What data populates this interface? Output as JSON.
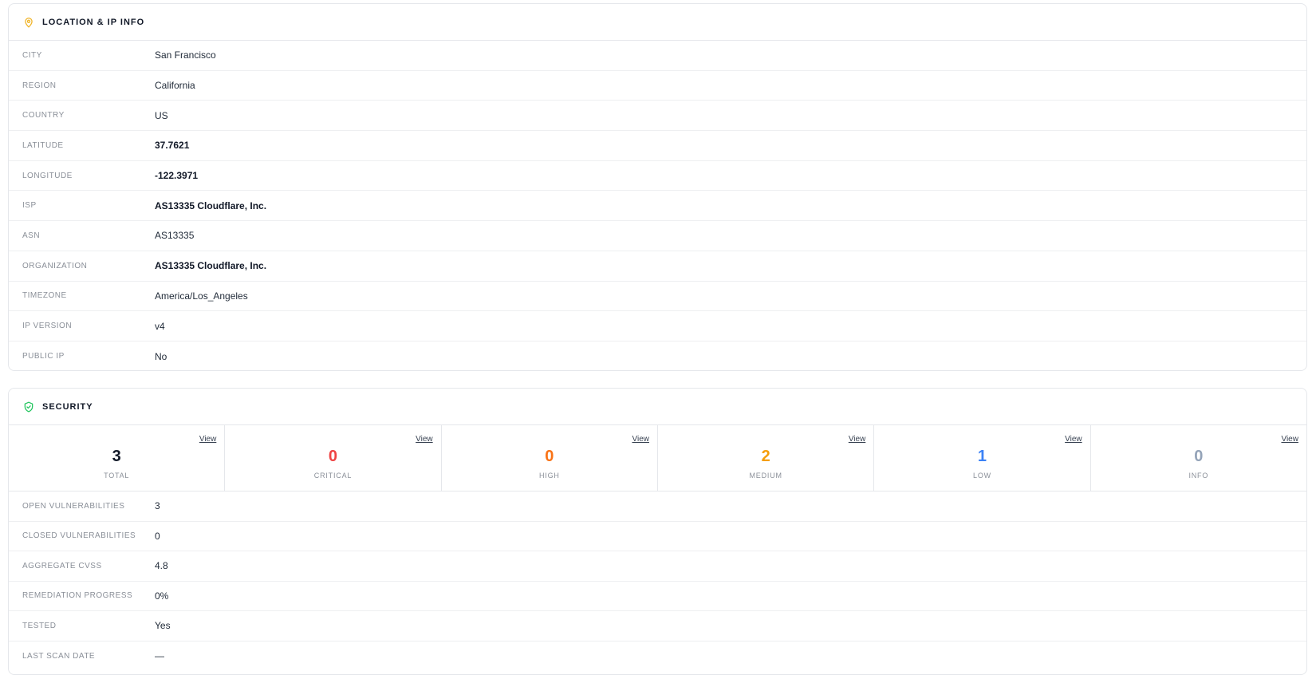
{
  "location": {
    "title": "Location & IP Info",
    "icon": "map-pin-icon",
    "icon_color": "#f0b429",
    "rows": [
      {
        "label": "City",
        "value": "San Francisco"
      },
      {
        "label": "Region",
        "value": "California"
      },
      {
        "label": "Country",
        "value": "US"
      },
      {
        "label": "Latitude",
        "value": "37.7621"
      },
      {
        "label": "Longitude",
        "value": "-122.3971"
      },
      {
        "label": "ISP",
        "value": "AS13335 Cloudflare, Inc."
      },
      {
        "label": "ASN",
        "value": "AS13335"
      },
      {
        "label": "Organization",
        "value": "AS13335 Cloudflare, Inc."
      },
      {
        "label": "Timezone",
        "value": "America/Los_Angeles"
      },
      {
        "label": "IP Version",
        "value": "v4"
      },
      {
        "label": "Public IP",
        "value": "No"
      }
    ]
  },
  "security": {
    "title": "Security",
    "icon": "shield-check-icon",
    "icon_color": "#22c55e",
    "view_label": "View",
    "stats": [
      {
        "count": "3",
        "label": "Total",
        "color": "#111827"
      },
      {
        "count": "0",
        "label": "Critical",
        "color": "#ef4444"
      },
      {
        "count": "0",
        "label": "High",
        "color": "#f97316"
      },
      {
        "count": "2",
        "label": "Medium",
        "color": "#f59e0b"
      },
      {
        "count": "1",
        "label": "Low",
        "color": "#3b82f6"
      },
      {
        "count": "0",
        "label": "Info",
        "color": "#94a3b8"
      }
    ],
    "rows": [
      {
        "label": "Open Vulnerabilities",
        "value": "3"
      },
      {
        "label": "Closed Vulnerabilities",
        "value": "0"
      },
      {
        "label": "Aggregate CVSS",
        "value": "4.8"
      },
      {
        "label": "Remediation Progress",
        "value": "0%"
      },
      {
        "label": "Tested",
        "value": "Yes"
      },
      {
        "label": "Last Scan Date",
        "value": "—"
      }
    ]
  }
}
